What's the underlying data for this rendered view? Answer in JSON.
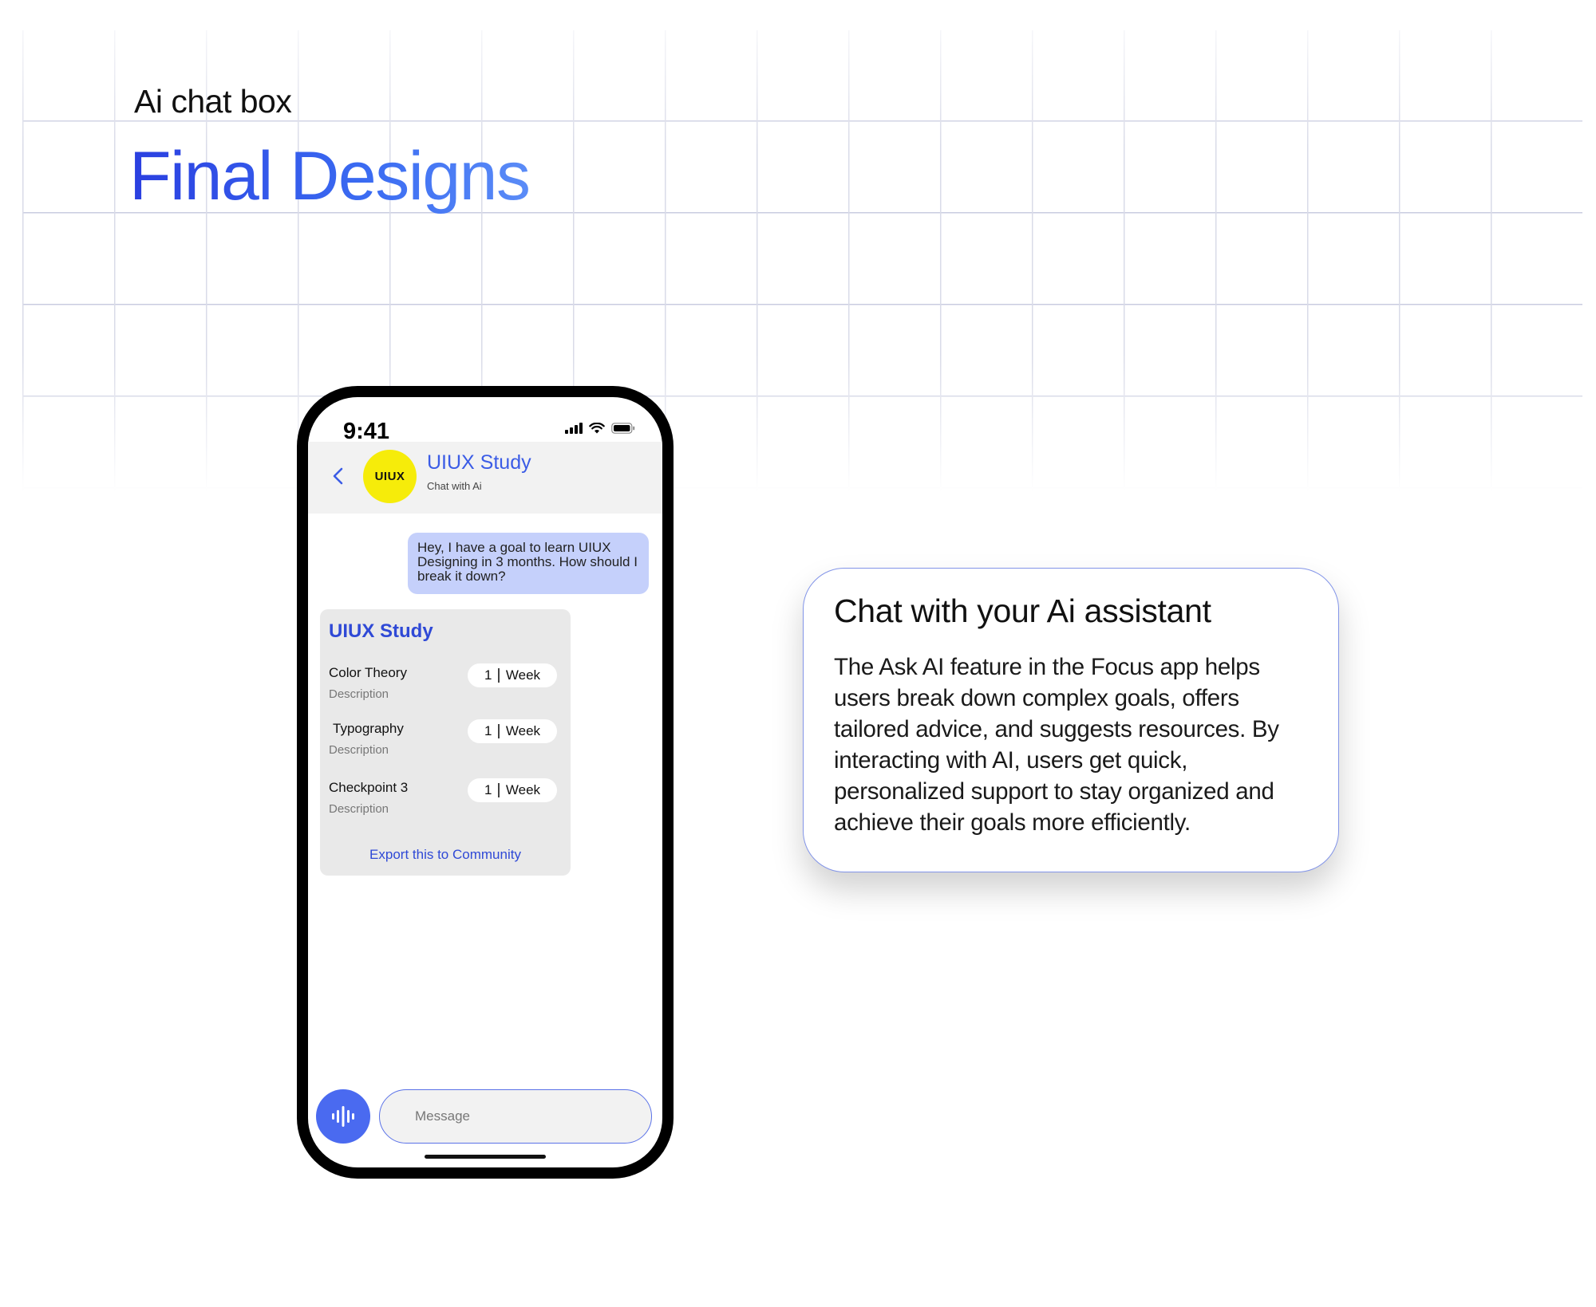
{
  "page": {
    "subtitle": "Ai chat box",
    "title": "Final Designs"
  },
  "phone": {
    "status_time": "9:41",
    "header": {
      "avatar_text": "UIUX",
      "name": "UIUX Study",
      "subtitle": "Chat with Ai"
    },
    "user_message": "Hey, I have a goal to learn UIUX Designing in 3 months. How should I break it down?",
    "ai_card": {
      "title": "UIUX Study",
      "rows": [
        {
          "label": "Color Theory",
          "description": "Description",
          "count": "1",
          "unit": "Week"
        },
        {
          "label": "Typography",
          "description": "Description",
          "count": "1",
          "unit": "Week"
        },
        {
          "label": "Checkpoint 3",
          "description": "Description",
          "count": "1",
          "unit": "Week"
        }
      ],
      "export_label": "Export this to Community"
    },
    "composer": {
      "placeholder": "Message",
      "voice_icon": "voice-wave-icon"
    }
  },
  "info_card": {
    "title": "Chat with your Ai assistant",
    "body": "The Ask AI feature in the Focus app helps users break down complex goals, offers tailored advice, and suggests resources. By interacting with AI, users get quick, personalized support to stay organized and achieve their goals more efficiently."
  },
  "colors": {
    "accent": "#3b5ce6",
    "title_gradient_start": "#2a3fe0",
    "avatar_yellow": "#f6ec0a",
    "user_bubble": "#c5d0fb",
    "voice_button": "#4a6af0"
  }
}
